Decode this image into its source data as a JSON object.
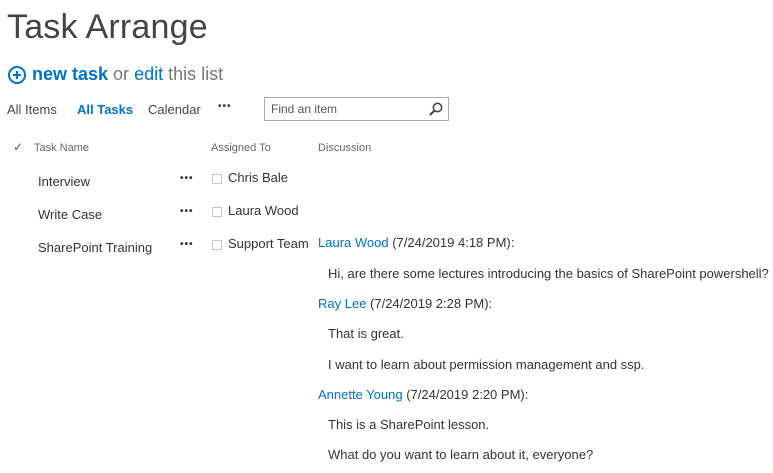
{
  "page": {
    "title": "Task Arrange"
  },
  "newbar": {
    "new_task": "new task",
    "or": "or",
    "edit": "edit",
    "this_list": "this list"
  },
  "views": [
    {
      "label": "All Items",
      "active": false
    },
    {
      "label": "All Tasks",
      "active": true
    },
    {
      "label": "Calendar",
      "active": false
    }
  ],
  "more_label": "•••",
  "search": {
    "placeholder": "Find an item"
  },
  "columns": {
    "check": "✓",
    "task_name": "Task Name",
    "assigned_to": "Assigned To",
    "discussion": "Discussion"
  },
  "rows": [
    {
      "task": "Interview",
      "menu": "•••",
      "assigned": "Chris Bale"
    },
    {
      "task": "Write Case",
      "menu": "•••",
      "assigned": "Laura Wood"
    },
    {
      "task": "SharePoint Training",
      "menu": "•••",
      "assigned": "Support Team"
    }
  ],
  "discussion": [
    {
      "author": "Laura Wood",
      "date": " (7/24/2019 4:18 PM):",
      "lines": [
        "Hi, are there some lectures introducing the basics of SharePoint powershell?"
      ]
    },
    {
      "author": "Ray Lee",
      "date": " (7/24/2019 2:28 PM):",
      "lines": [
        "That is great.",
        "I want to learn about permission management and ssp."
      ]
    },
    {
      "author": "Annette Young",
      "date": " (7/24/2019 2:20 PM):",
      "lines": [
        "This is a SharePoint lesson.",
        "What do you want to learn about it, everyone?"
      ]
    }
  ],
  "colors": {
    "accent": "#0072c6",
    "text": "#444444"
  }
}
